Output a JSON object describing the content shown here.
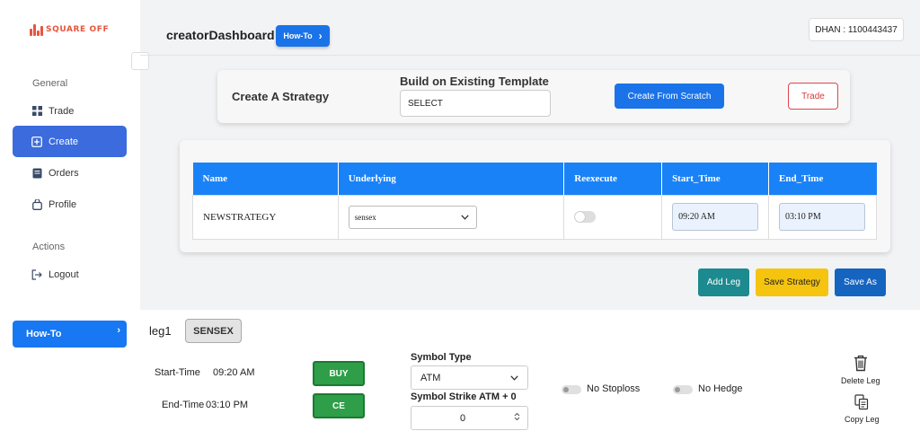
{
  "brand": {
    "logo_text": "SQUARE OFF"
  },
  "sidebar": {
    "section_general": "General",
    "section_actions": "Actions",
    "items": [
      {
        "label": "Trade",
        "icon": "grid-icon"
      },
      {
        "label": "Create",
        "icon": "plus-square-icon",
        "active": true
      },
      {
        "label": "Orders",
        "icon": "book-icon"
      },
      {
        "label": "Profile",
        "icon": "bag-icon"
      },
      {
        "label": "Logout",
        "icon": "logout-icon"
      }
    ],
    "howto_label": "How-To"
  },
  "header": {
    "title": "creatorDashboard",
    "howto_label": "How-To",
    "account_badge": "DHAN : 1100443437"
  },
  "strategy_bar": {
    "create_label": "Create A Strategy",
    "build_label": "Build on Existing Template",
    "template_value": "SELECT",
    "scratch_button": "Create From Scratch",
    "trade_button": "Trade"
  },
  "strategy_table": {
    "headers": [
      "Name",
      "Underlying",
      "Reexecute",
      "Start_Time",
      "End_Time"
    ],
    "row": {
      "name": "NEWSTRATEGY",
      "underlying": "sensex",
      "reexecute": false,
      "start_time": "09:20 AM",
      "end_time": "03:10 PM"
    }
  },
  "actions": {
    "add_leg": "Add Leg",
    "save_strategy": "Save Strategy",
    "save_as": "Save As"
  },
  "leg": {
    "name": "leg1",
    "underlying_chip": "SENSEX",
    "start_label": "Start-Time",
    "start_value": "09:20 AM",
    "end_label": "End-Time",
    "end_value": "03:10 PM",
    "side_button": "BUY",
    "option_button": "CE",
    "symbol_type_label": "Symbol Type",
    "symbol_type_value": "ATM",
    "strike_label": "Symbol Strike ATM + 0",
    "strike_value": "0",
    "stoploss_label": "No Stoploss",
    "hedge_label": "No Hedge",
    "delete_label": "Delete Leg",
    "copy_label": "Copy Leg"
  },
  "colors": {
    "primary": "#1a73e8",
    "sidebar_active": "#3b6bdc",
    "table_header": "#1a82f7",
    "add_leg": "#1c8a8f",
    "save_strategy": "#f5c40f",
    "save_as": "#1565c0",
    "buy": "#2e9e48",
    "trade_outline": "#e0454a",
    "logo": "#e8553d"
  }
}
